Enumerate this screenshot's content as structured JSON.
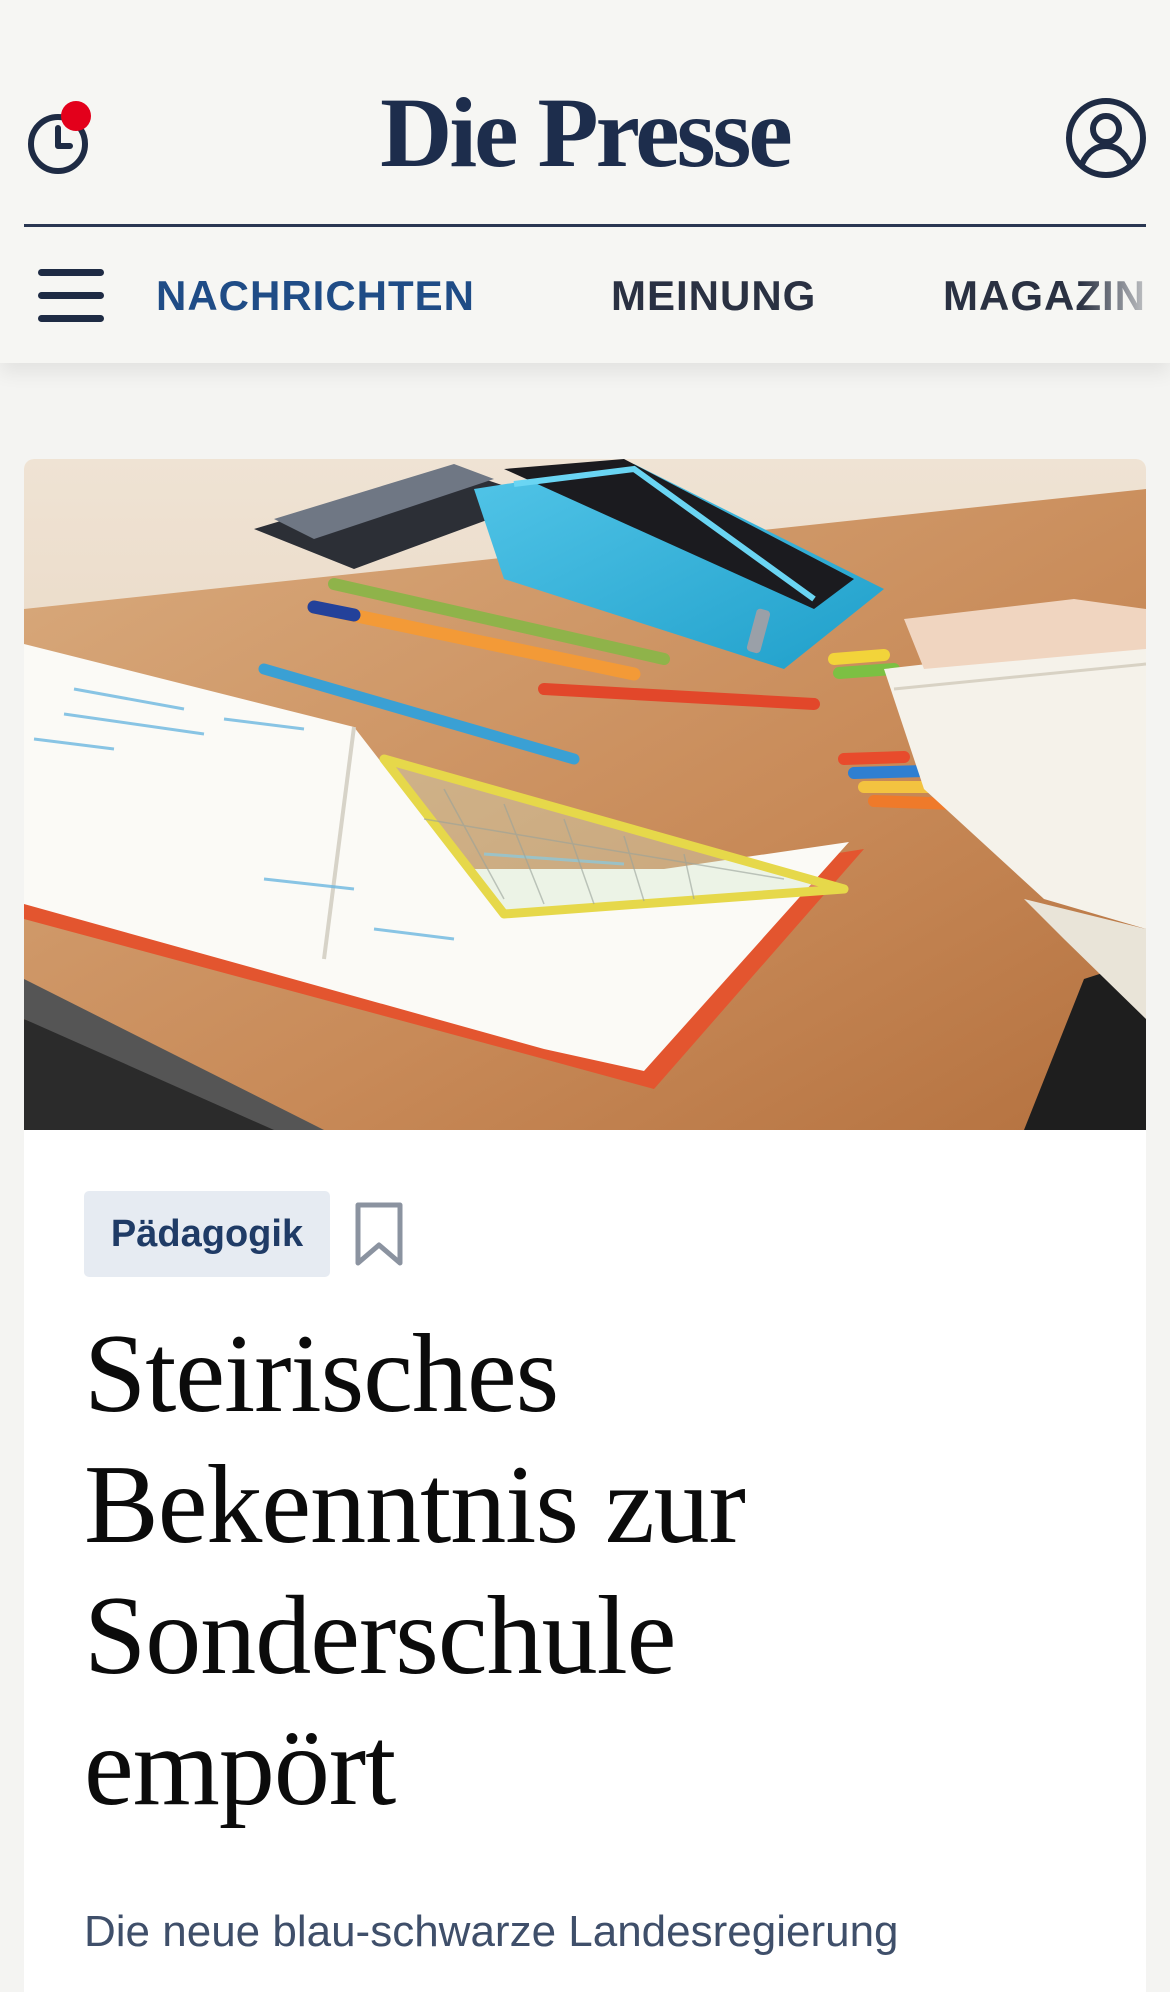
{
  "header": {
    "logo": "Die Presse",
    "history_icon": "clock-icon",
    "history_badge_color": "#e3001b",
    "profile_icon": "user-icon",
    "brand_color": "#1d2d4c"
  },
  "nav": {
    "menu_icon": "hamburger-menu-icon",
    "items": [
      {
        "label": "NACHRICHTEN",
        "active": true
      },
      {
        "label": "MEINUNG",
        "active": false
      },
      {
        "label": "MAGAZIN",
        "active": false
      }
    ],
    "active_color": "#1f4c86"
  },
  "article": {
    "category": "Pädagogik",
    "bookmark_icon": "bookmark-icon",
    "headline_lines": [
      "Steirisches",
      "Bekenntnis zur",
      "Sonderschule",
      "empört"
    ],
    "lead": "Die neue blau-schwarze Landesregierung",
    "image_subject": "open school notebooks, pencils, set square and a blue pencil case on a wooden desk"
  }
}
